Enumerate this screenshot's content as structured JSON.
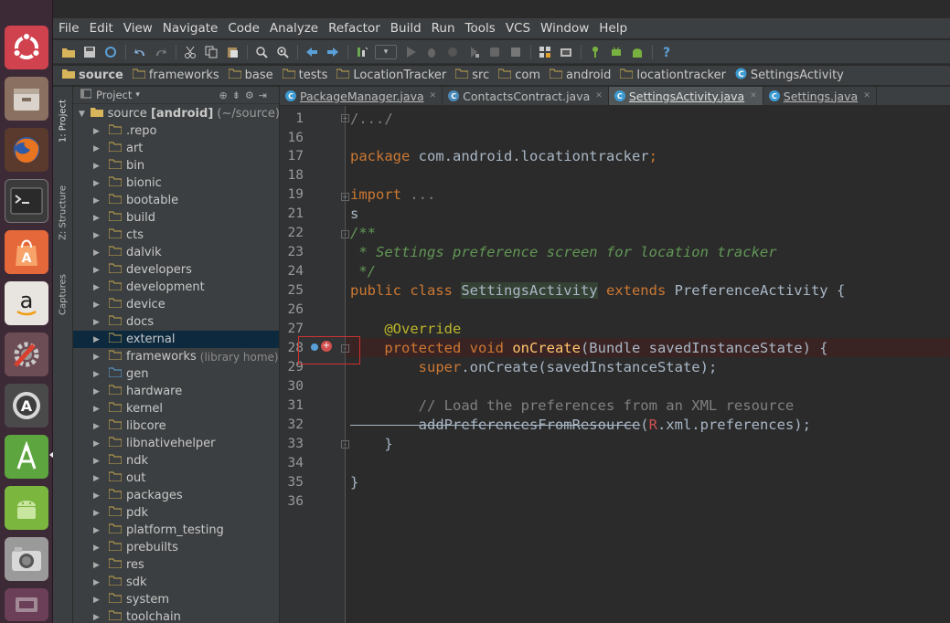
{
  "launcher": {
    "items": [
      {
        "name": "ubuntu-dash-icon"
      },
      {
        "name": "files-icon"
      },
      {
        "name": "firefox-icon"
      },
      {
        "name": "terminal-icon"
      },
      {
        "name": "software-center-icon"
      },
      {
        "name": "amazon-icon",
        "glyph": "a"
      },
      {
        "name": "system-settings-icon"
      },
      {
        "name": "update-manager-icon"
      },
      {
        "name": "android-studio-icon"
      },
      {
        "name": "android-icon"
      },
      {
        "name": "camera-icon"
      },
      {
        "name": "workspace-switcher-icon"
      }
    ]
  },
  "menu": [
    "File",
    "Edit",
    "View",
    "Navigate",
    "Code",
    "Analyze",
    "Refactor",
    "Build",
    "Run",
    "Tools",
    "VCS",
    "Window",
    "Help"
  ],
  "breadcrumbs": [
    "source",
    "frameworks",
    "base",
    "tests",
    "LocationTracker",
    "src",
    "com",
    "android",
    "locationtracker",
    "SettingsActivity"
  ],
  "toolstrip": {
    "project_tab": "1: Project",
    "structure_tab": "Z: Structure",
    "captures_tab": "Captures"
  },
  "project": {
    "header": "Project",
    "root_label": "source",
    "root_module": "[android]",
    "root_path": "(~/source)",
    "items": [
      {
        "label": "repo"
      },
      {
        "label": "art"
      },
      {
        "label": "bin"
      },
      {
        "label": "bionic"
      },
      {
        "label": "bootable"
      },
      {
        "label": "build"
      },
      {
        "label": "cts"
      },
      {
        "label": "dalvik"
      },
      {
        "label": "developers"
      },
      {
        "label": "development"
      },
      {
        "label": "device"
      },
      {
        "label": "docs"
      },
      {
        "label": "external"
      },
      {
        "label": "frameworks",
        "hint": "library home"
      },
      {
        "label": "gen"
      },
      {
        "label": "hardware"
      },
      {
        "label": "kernel"
      },
      {
        "label": "libcore"
      },
      {
        "label": "libnativehelper"
      },
      {
        "label": "ndk"
      },
      {
        "label": "out"
      },
      {
        "label": "packages"
      },
      {
        "label": "pdk"
      },
      {
        "label": "platform_testing"
      },
      {
        "label": "prebuilts"
      },
      {
        "label": "res"
      },
      {
        "label": "sdk"
      },
      {
        "label": "system"
      },
      {
        "label": "toolchain"
      }
    ]
  },
  "tabs": [
    {
      "label": "PackageManager.java"
    },
    {
      "label": "ContactsContract.java"
    },
    {
      "label": "SettingsActivity.java"
    },
    {
      "label": "Settings.java"
    }
  ],
  "editor": {
    "line_numbers": [
      "1",
      "16",
      "17",
      "18",
      "19",
      "21",
      "22",
      "23",
      "24",
      "25",
      "26",
      "27",
      "28",
      "29",
      "30",
      "31",
      "32",
      "33",
      "34",
      "35",
      "36"
    ],
    "fold1": "/.../",
    "pkg_kw": "package",
    "pkg_name": " com.android.locationtracker",
    "semi": ";",
    "import_kw": "import",
    "import_dots": " ...",
    "stray_s": "s",
    "doc_open": "/**",
    "doc_line": " * Settings preference screen for location tracker",
    "doc_close": " */",
    "class_kw": "public class ",
    "class_name": "SettingsActivity",
    "extends_kw": " extends ",
    "super_class": "PreferenceActivity {",
    "override": "    @Override",
    "method_kw": "    protected void ",
    "method_name": "onCreate",
    "method_params": "(Bundle savedInstanceState) {",
    "super_kw": "        super",
    "super_call": ".onCreate(savedInstanceState);",
    "comment": "        // Load the preferences from an XML resource",
    "add_prefs": "        addPreferencesFromResource",
    "r_paren": "(",
    "r_res": "R",
    "xml_rest": ".xml.preferences);",
    "close_method": "    }",
    "close_class": "}"
  },
  "colors": {
    "keyword": "#cc7832",
    "comment": "#629755",
    "annotation": "#bbb529",
    "method": "#ffc66d",
    "text": "#a9b7c6",
    "selection": "#0d293e"
  }
}
